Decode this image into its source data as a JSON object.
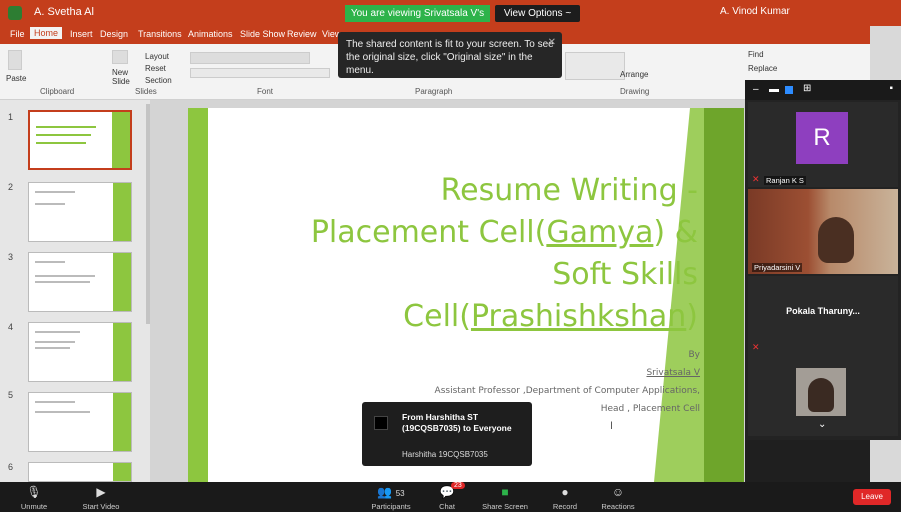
{
  "titlebar": {
    "doc_title": "A. Svetha Al",
    "share_banner": "You are viewing Srivatsala V's screen",
    "view_options": "View Options ~",
    "user": "A. Vinod Kumar"
  },
  "tabs": [
    "File",
    "Home",
    "Insert",
    "Design",
    "Transitions",
    "Animations",
    "Slide Show",
    "Review",
    "View"
  ],
  "ribbon": {
    "groups": [
      "Clipboard",
      "Slides",
      "Font",
      "Paragraph",
      "Drawing"
    ],
    "paste": "Paste",
    "new_slide": "New Slide",
    "layout": "Layout",
    "reset": "Reset",
    "section": "Section",
    "arrange": "Arrange",
    "find": "Find",
    "replace": "Replace"
  },
  "tooltip": {
    "text": "The shared content is fit to your screen. To see the original size, click \"Original size\" in the menu."
  },
  "thumbnails": [
    "1",
    "2",
    "3",
    "4",
    "5",
    "6"
  ],
  "slide": {
    "title_lines": [
      "Resume Writing -",
      "Placement Cell(",
      "Gamya",
      ") &",
      "Soft Skills",
      "Cell(",
      "Prashishkshan",
      ")"
    ],
    "by": "By",
    "author": "Srivatsala V",
    "role": "Assistant Professor ,Department of Computer Applications,",
    "head": "Head , Placement Cell"
  },
  "chat_notification": {
    "from": "From Harshitha ST (19CQSB7035) to Everyone",
    "message": "Harshitha 19CQSB7035"
  },
  "participants_panel": {
    "tiles": [
      {
        "avatar_letter": "R",
        "name": "Ranjan K S"
      },
      {
        "name": "Priyadarsini V"
      },
      {
        "name": "Pokala Tharuny..."
      }
    ]
  },
  "toolbar": {
    "unmute": "Unmute",
    "start_video": "Start Video",
    "participants": "Participants",
    "participants_count": "53",
    "chat": "Chat",
    "chat_badge": "23",
    "share_screen": "Share Screen",
    "record": "Record",
    "reactions": "Reactions",
    "leave": "Leave"
  },
  "colors": {
    "accent": "#c43e1c",
    "slide_green": "#8dc63f",
    "zoom_green": "#2db34a",
    "leave_red": "#e02828"
  }
}
